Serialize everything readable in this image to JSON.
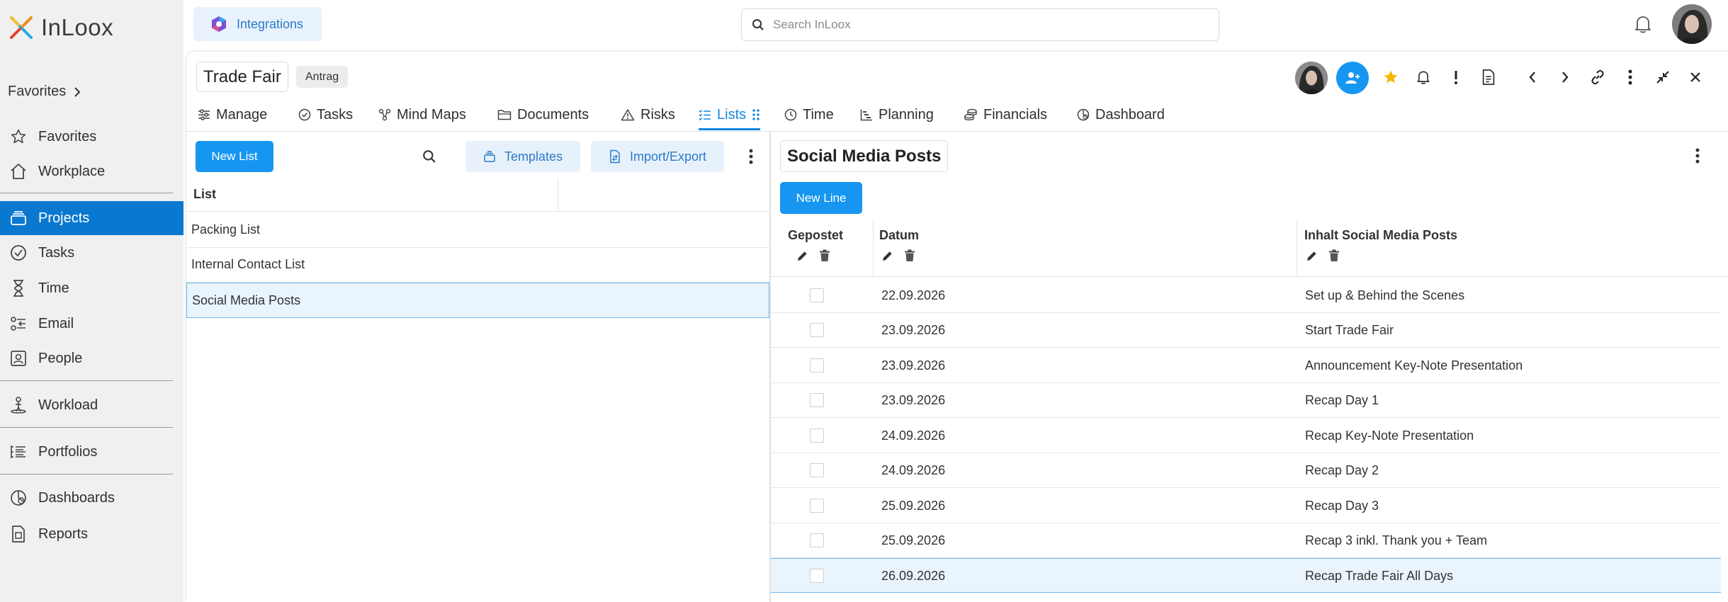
{
  "app": {
    "name": "InLoox",
    "logo_icon": "inloox-x-logo"
  },
  "sidebar": {
    "favorites_header": "Favorites",
    "items": [
      {
        "label": "Favorites",
        "icon": "star-icon"
      },
      {
        "label": "Workplace",
        "icon": "home-icon"
      },
      {
        "label": "Projects",
        "icon": "projects-icon",
        "active": true
      },
      {
        "label": "Tasks",
        "icon": "check-circle-icon"
      },
      {
        "label": "Time",
        "icon": "hourglass-icon"
      },
      {
        "label": "Email",
        "icon": "email-icon"
      },
      {
        "label": "People",
        "icon": "contact-card-icon"
      },
      {
        "label": "Workload",
        "icon": "workload-icon"
      },
      {
        "label": "Portfolios",
        "icon": "portfolio-list-icon"
      },
      {
        "label": "Dashboards",
        "icon": "dashboard-gauge-icon"
      },
      {
        "label": "Reports",
        "icon": "report-icon"
      }
    ]
  },
  "topbar": {
    "integrations_label": "Integrations",
    "search_placeholder": "Search InLoox"
  },
  "project": {
    "title": "Trade Fair",
    "status": "Antrag",
    "tabs": [
      {
        "label": "Manage",
        "icon": "sliders-icon"
      },
      {
        "label": "Tasks",
        "icon": "check-circle-icon"
      },
      {
        "label": "Mind Maps",
        "icon": "mindmap-icon"
      },
      {
        "label": "Documents",
        "icon": "folder-icon"
      },
      {
        "label": "Risks",
        "icon": "warning-triangle-icon"
      },
      {
        "label": "Lists",
        "icon": "list-icon",
        "active": true
      },
      {
        "label": "Time",
        "icon": "clock-icon"
      },
      {
        "label": "Planning",
        "icon": "gantt-icon"
      },
      {
        "label": "Financials",
        "icon": "coins-icon"
      },
      {
        "label": "Dashboard",
        "icon": "dashboard-gauge-icon"
      }
    ]
  },
  "lists_pane": {
    "new_list_label": "New List",
    "templates_label": "Templates",
    "import_export_label": "Import/Export",
    "column_header": "List",
    "items": [
      {
        "name": "Packing List"
      },
      {
        "name": "Internal Contact List"
      },
      {
        "name": "Social Media Posts",
        "selected": true
      }
    ]
  },
  "detail": {
    "title": "Social Media Posts",
    "new_line_label": "New Line",
    "columns": [
      "Gepostet",
      "Datum",
      "Inhalt Social Media Posts"
    ],
    "rows": [
      {
        "posted": false,
        "date": "22.09.2026",
        "content": "Set up & Behind the Scenes"
      },
      {
        "posted": false,
        "date": "23.09.2026",
        "content": "Start Trade Fair"
      },
      {
        "posted": false,
        "date": "23.09.2026",
        "content": "Announcement Key-Note Presentation"
      },
      {
        "posted": false,
        "date": "23.09.2026",
        "content": "Recap Day 1"
      },
      {
        "posted": false,
        "date": "24.09.2026",
        "content": "Recap Key-Note Presentation"
      },
      {
        "posted": false,
        "date": "24.09.2026",
        "content": "Recap Day 2"
      },
      {
        "posted": false,
        "date": "25.09.2026",
        "content": "Recap Day 3"
      },
      {
        "posted": false,
        "date": "25.09.2026",
        "content": "Recap 3 inkl. Thank you + Team"
      },
      {
        "posted": false,
        "date": "26.09.2026",
        "content": "Recap Trade Fair All Days",
        "selected": true
      }
    ]
  },
  "colors": {
    "accent": "#1696f0",
    "nav_active": "#0b78d0",
    "soft_button": "#e7f1fb",
    "selection": "#e9f4fd",
    "star": "#f5b800"
  }
}
